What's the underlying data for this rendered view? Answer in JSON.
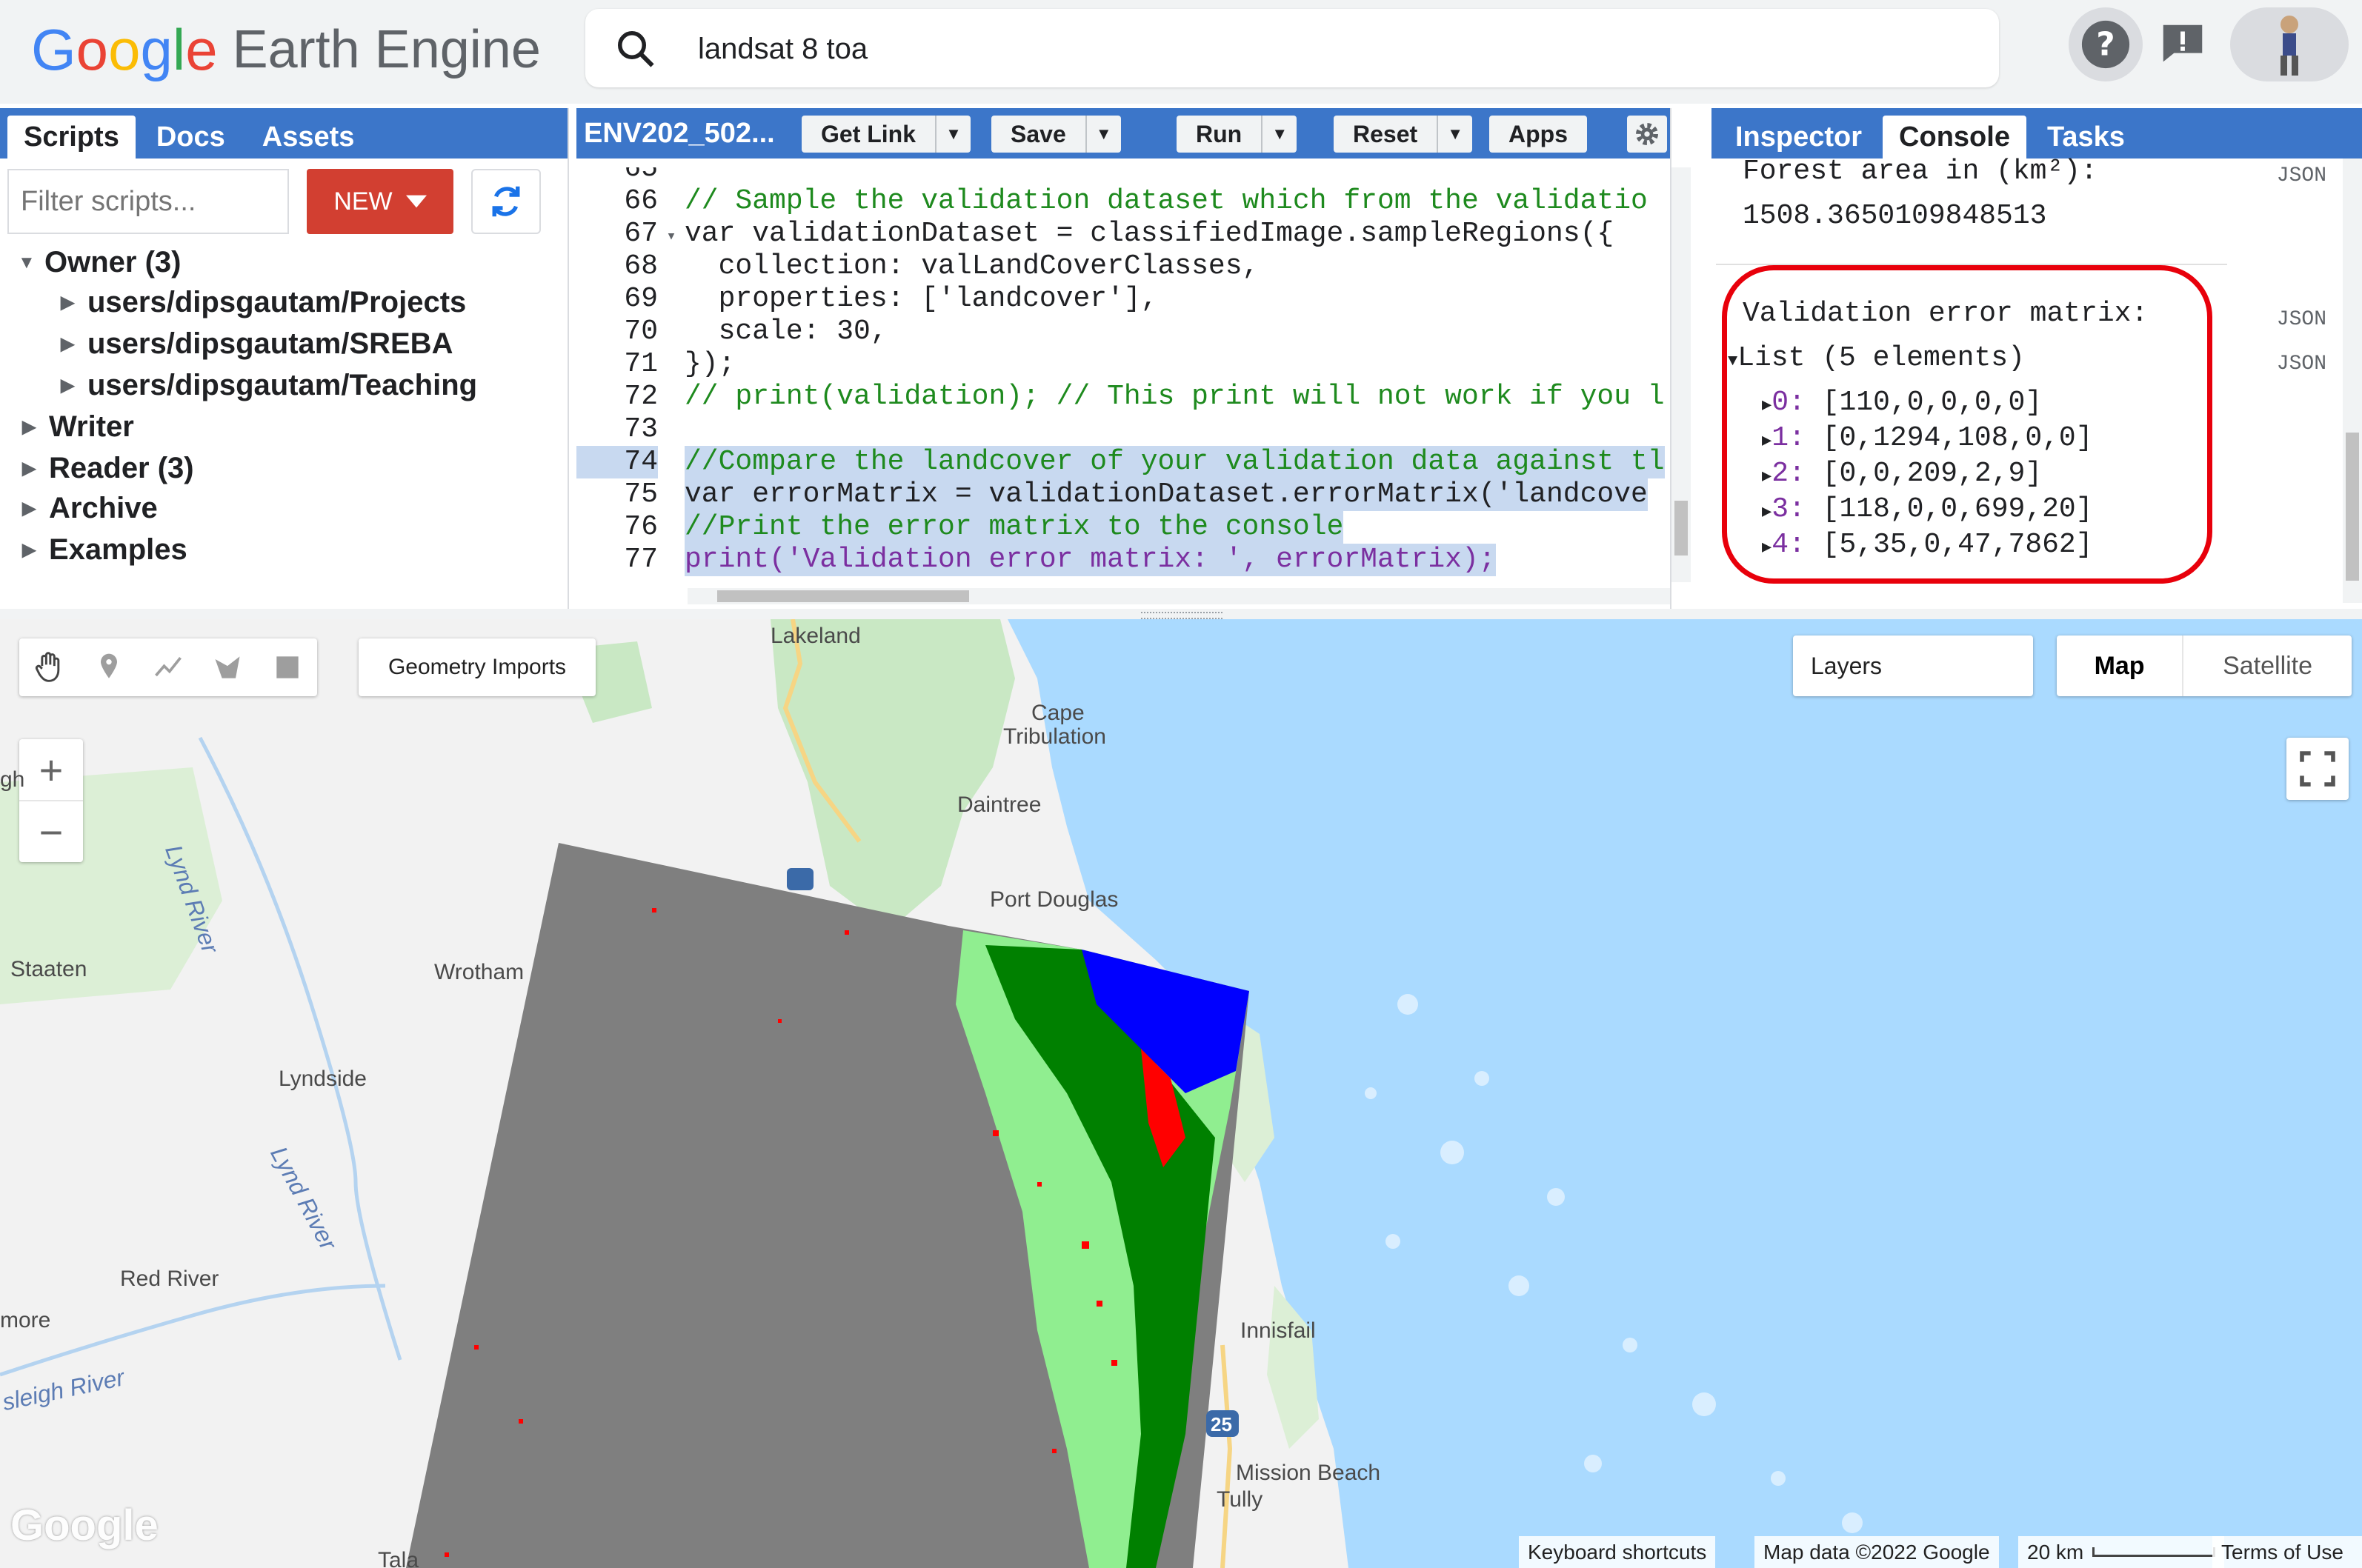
{
  "header": {
    "logo_google": [
      "G",
      "o",
      "o",
      "g",
      "l",
      "e"
    ],
    "logo_product": "Earth Engine",
    "search_value": "landsat 8 toa"
  },
  "left_panel": {
    "tabs": [
      "Scripts",
      "Docs",
      "Assets"
    ],
    "active_tab": "Scripts",
    "filter_placeholder": "Filter scripts...",
    "new_label": "NEW",
    "tree": [
      {
        "label": "Owner (3)",
        "expanded": true
      },
      {
        "label": "users/dipsgautam/Projects"
      },
      {
        "label": "users/dipsgautam/SREBA"
      },
      {
        "label": "users/dipsgautam/Teaching"
      },
      {
        "label": "Writer"
      },
      {
        "label": "Reader (3)"
      },
      {
        "label": "Archive"
      },
      {
        "label": "Examples"
      }
    ]
  },
  "editor": {
    "title": "ENV202_502...",
    "buttons": {
      "get_link": "Get Link",
      "save": "Save",
      "run": "Run",
      "reset": "Reset",
      "apps": "Apps"
    },
    "lines": [
      {
        "n": "65",
        "text": ""
      },
      {
        "n": "66",
        "text": "// Sample the validation dataset which from the validatio"
      },
      {
        "n": "67",
        "text": "var validationDataset = classifiedImage.sampleRegions({"
      },
      {
        "n": "68",
        "text": "  collection: valLandCoverClasses,"
      },
      {
        "n": "69",
        "text": "  properties: ['landcover'],"
      },
      {
        "n": "70",
        "text": "  scale: 30,"
      },
      {
        "n": "71",
        "text": "});"
      },
      {
        "n": "72",
        "text": "// print(validation); // This print will not work if you l"
      },
      {
        "n": "73",
        "text": ""
      },
      {
        "n": "74",
        "text": "//Compare the landcover of your validation data against tl"
      },
      {
        "n": "75",
        "text": "var errorMatrix = validationDataset.errorMatrix('landcove"
      },
      {
        "n": "76",
        "text": "//Print the error matrix to the console"
      },
      {
        "n": "77",
        "text": "print('Validation error matrix: ', errorMatrix);"
      }
    ]
  },
  "right_panel": {
    "tabs": [
      "Inspector",
      "Console",
      "Tasks"
    ],
    "active_tab": "Console",
    "json_label": "JSON",
    "forest_label": "Forest area in (km²):",
    "forest_value": "1508.3650109848513",
    "matrix_label": "Validation error matrix:",
    "list_label": "List (5 elements)",
    "rows": [
      {
        "idx": "0:",
        "val": "[110,0,0,0,0]"
      },
      {
        "idx": "1:",
        "val": "[0,1294,108,0,0]"
      },
      {
        "idx": "2:",
        "val": "[0,0,209,2,9]"
      },
      {
        "idx": "3:",
        "val": "[118,0,0,699,20]"
      },
      {
        "idx": "4:",
        "val": "[5,35,0,47,7862]"
      }
    ],
    "highlight_color": "#e8000b"
  },
  "map": {
    "geometry_imports": "Geometry Imports",
    "layers": "Layers",
    "map_btn": "Map",
    "satellite_btn": "Satellite",
    "zoom_in": "+",
    "zoom_out": "−",
    "places": [
      "Lakeland",
      "Cape",
      "Tribulation",
      "Daintree",
      "Port Douglas",
      "Staaten",
      "Wrotham",
      "Lyndside",
      "Red River",
      "more",
      "Innisfail",
      "Mission Beach",
      "Tully",
      "Tala",
      "gh"
    ],
    "rivers": [
      "Lynd River",
      "Lynd River",
      "sleigh River"
    ],
    "road_shield": "25",
    "google_watermark": "Google",
    "footer": {
      "shortcuts": "Keyboard shortcuts",
      "mapdata": "Map data ©2022 Google",
      "scale": "20 km",
      "terms": "Terms of Use"
    },
    "colors": {
      "sea": "#aadaff",
      "land": "#f2f2f2",
      "park": "#c9e8c4",
      "gray": "#7f7f7f",
      "red": "#ff0000",
      "green": "#008000",
      "lightgreen": "#90ee90",
      "blue": "#0000ff"
    }
  }
}
